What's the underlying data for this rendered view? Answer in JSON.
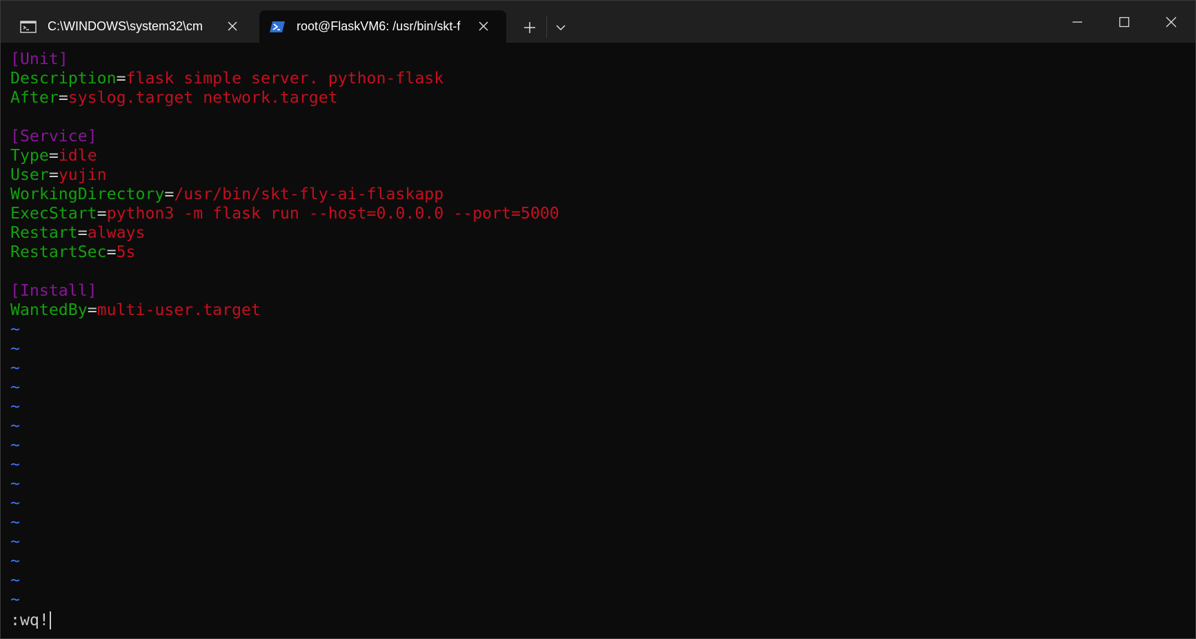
{
  "tabs": [
    {
      "label": "C:\\WINDOWS\\system32\\cm",
      "icon": "cmd-icon",
      "active": false
    },
    {
      "label": "root@FlaskVM6: /usr/bin/skt-f",
      "icon": "powershell-icon",
      "active": true
    }
  ],
  "window_controls": [
    "minimize",
    "maximize",
    "close"
  ],
  "terminal": {
    "lines": [
      {
        "section": "[Unit]"
      },
      {
        "key": "Description",
        "eq": "=",
        "value": "flask simple server. python-flask"
      },
      {
        "key": "After",
        "eq": "=",
        "value": "syslog.target network.target"
      },
      {
        "blank": ""
      },
      {
        "section": "[Service]"
      },
      {
        "key": "Type",
        "eq": "=",
        "value": "idle"
      },
      {
        "key": "User",
        "eq": "=",
        "value": "yujin"
      },
      {
        "key": "WorkingDirectory",
        "eq": "=",
        "value": "/usr/bin/skt-fly-ai-flaskapp"
      },
      {
        "key": "ExecStart",
        "eq": "=",
        "value": "python3 -m flask run --host=0.0.0.0 --port=5000"
      },
      {
        "key": "Restart",
        "eq": "=",
        "value": "always"
      },
      {
        "key": "RestartSec",
        "eq": "=",
        "value": "5s"
      },
      {
        "blank": ""
      },
      {
        "section": "[Install]"
      },
      {
        "key": "WantedBy",
        "eq": "=",
        "value": "multi-user.target"
      }
    ],
    "tilde": "~",
    "tilde_count": 15,
    "command_line": ":wq!"
  },
  "colors": {
    "background": "#0c0c0c",
    "titlebar": "#202020",
    "section": "#881798",
    "key": "#13a10e",
    "value": "#c50f1f",
    "tilde": "#3b78ff",
    "text": "#cccccc"
  }
}
